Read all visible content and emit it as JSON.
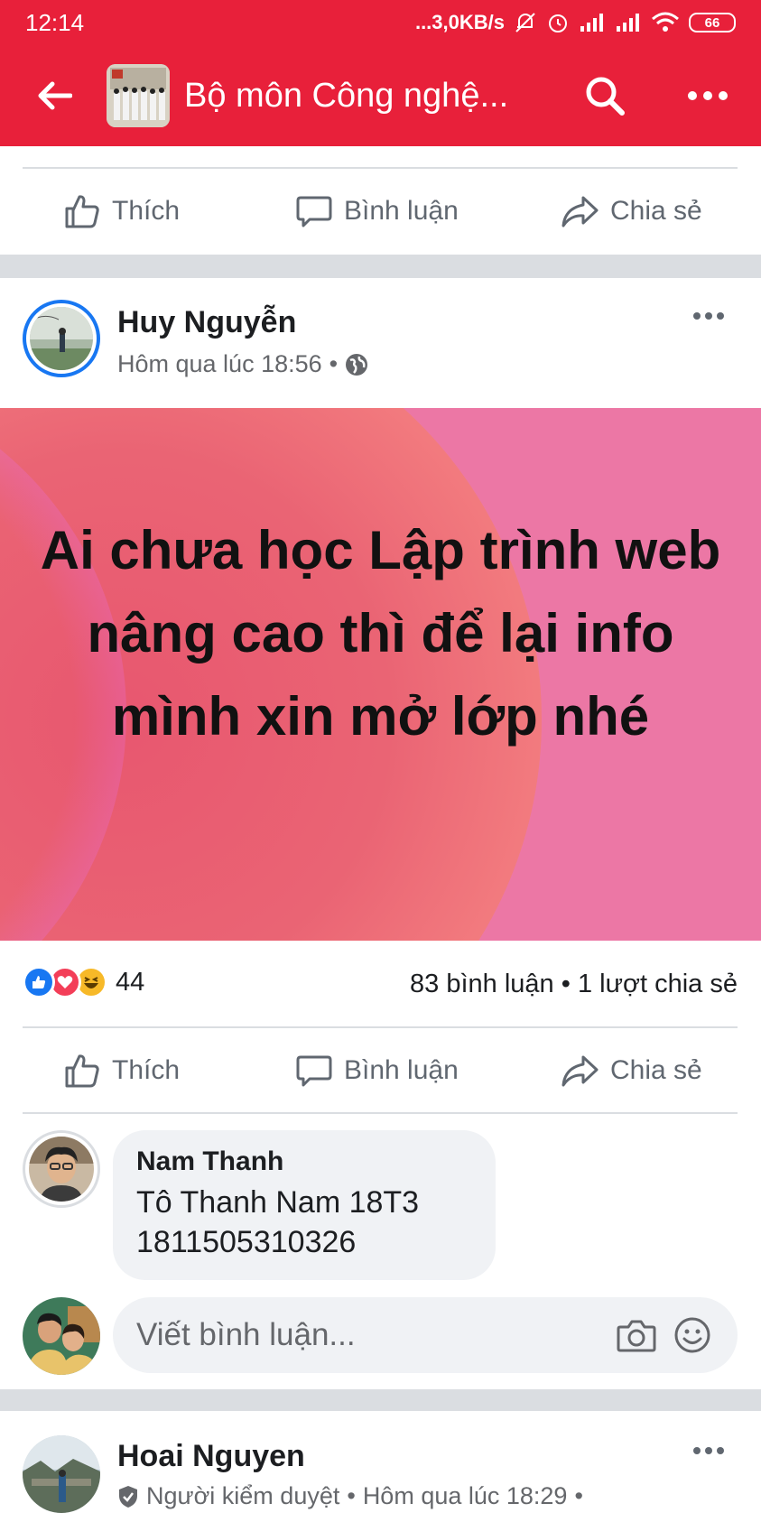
{
  "status_bar": {
    "time": "12:14",
    "network_speed": "...3,0KB/s",
    "battery": "66",
    "icons": [
      "mute-icon",
      "alarm-icon",
      "signal-icon",
      "signal-icon",
      "wifi-icon",
      "battery-icon"
    ]
  },
  "app_bar": {
    "title": "Bộ môn Công nghệ...",
    "icons": [
      "back-arrow-icon",
      "group-thumbnail",
      "search-icon",
      "more-icon"
    ]
  },
  "actions": {
    "like": "Thích",
    "comment": "Bình luận",
    "share": "Chia sẻ"
  },
  "post": {
    "author": "Huy Nguyễn",
    "time": "Hôm qua lúc 18:56",
    "separator": "•",
    "privacy_icon": "globe-icon",
    "text": "Ai chưa học Lập trình web nâng cao thì để lại info mình xin mở lớp nhé",
    "reaction_icons": [
      "like-reaction",
      "love-reaction",
      "haha-reaction"
    ],
    "reaction_count": "44",
    "stats": "83 bình luận • 1 lượt chia sẻ"
  },
  "comment": {
    "author": "Nam Thanh",
    "text_line1": "Tô Thanh Nam 18T3",
    "text_line2": "1811505310326"
  },
  "write_comment": {
    "placeholder": "Viết bình luận...",
    "icons": [
      "camera-icon",
      "emoji-icon"
    ]
  },
  "next_post": {
    "author": "Hoai Nguyen",
    "badge": "Người kiểm duyệt",
    "time": "Hôm qua lúc 18:29",
    "separator": "•"
  },
  "colors": {
    "brand": "#e8203a",
    "like_blue": "#1877f2",
    "love_red": "#f33e58",
    "haha_yellow": "#f7b928",
    "banner_pink": "#ec77a5",
    "banner_orange": "#f79078"
  }
}
